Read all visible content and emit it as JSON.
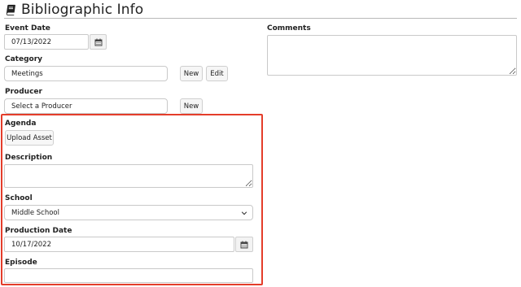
{
  "header": {
    "title": "Bibliographic Info"
  },
  "event_date": {
    "label": "Event Date",
    "value": "07/13/2022"
  },
  "category": {
    "label": "Category",
    "value": "Meetings",
    "new_label": "New",
    "edit_label": "Edit"
  },
  "producer": {
    "label": "Producer",
    "placeholder": "Select a Producer",
    "new_label": "New"
  },
  "agenda": {
    "label": "Agenda",
    "upload_label": "Upload Asset"
  },
  "description": {
    "label": "Description",
    "value": ""
  },
  "school": {
    "label": "School",
    "value": "Middle School"
  },
  "production_date": {
    "label": "Production Date",
    "value": "10/17/2022"
  },
  "episode": {
    "label": "Episode",
    "value": ""
  },
  "comments": {
    "label": "Comments",
    "value": ""
  },
  "colors": {
    "highlight": "#e43d2a"
  },
  "icons": [
    "book-icon",
    "calendar-icon",
    "chevron-down-icon"
  ]
}
